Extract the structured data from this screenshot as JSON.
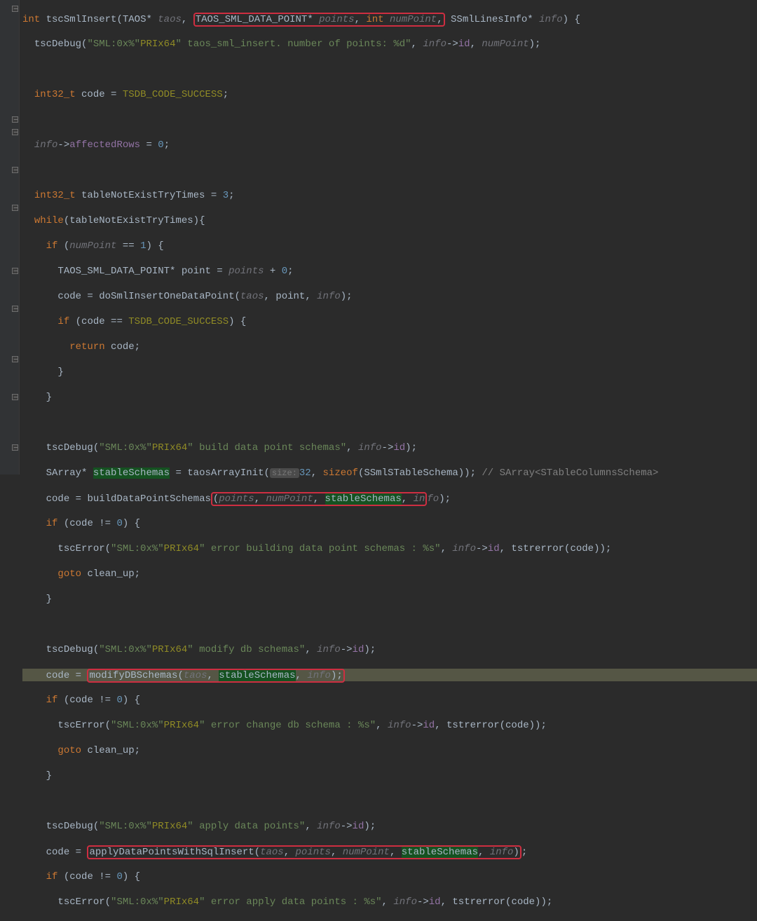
{
  "func": {
    "ret": "int",
    "name": "tscSmlInsert",
    "p_taos_ty": "TAOS*",
    "p_taos": "taos",
    "p_points_ty": "TAOS_SML_DATA_POINT*",
    "p_points": "points",
    "p_num_ty": "int",
    "p_num": "numPoint",
    "p_info_ty": "SSmlLinesInfo*",
    "p_info": "info"
  },
  "s": {
    "dbg_hdr": "\"SML:0x%\"",
    "prix64": "PRIx64",
    "dbg_numpts": "\" taos_sml_insert. number of points: %d\"",
    "dbg_build": "\" build data point schemas\"",
    "dbg_err_build": "\" error building data point schemas : %s\"",
    "dbg_modify": "\" modify db schemas\"",
    "dbg_err_modify": "\" error change db schema : %s\"",
    "dbg_apply": "\" apply data points\"",
    "dbg_err_apply": "\" error apply data points : %s\""
  },
  "n": {
    "zero": "0",
    "one": "1",
    "three": "3",
    "thirtytwo": "32"
  },
  "id": {
    "tscDebug": "tscDebug",
    "tscError": "tscError",
    "code": "code",
    "int32": "int32_t",
    "success": "TSDB_CODE_SUCCESS",
    "info": "info",
    "affectedRows": "affectedRows",
    "tableTry": "tableNotExistTryTimes",
    "while": "while",
    "if": "if",
    "return": "return",
    "goto": "goto",
    "clean_up": "clean_up",
    "points_ty": "TAOS_SML_DATA_POINT*",
    "point": "point",
    "points": "points",
    "doSmlInsert": "doSmlInsertOneDataPoint",
    "SArray": "SArray*",
    "stableSchemas": "stableSchemas",
    "taosArrayInit": "taosArrayInit",
    "sizeof": "sizeof",
    "SSmlSTable": "SSmlSTableSchema",
    "cmt_sarray": "// SArray<STableColumnsSchema>",
    "buildDPS": "buildDataPointSchemas",
    "modifyDB": "modifyDBSchemas",
    "applyDP": "applyDataPointsWithSqlInsert",
    "numPoint": "numPoint",
    "taos": "taos",
    "id": "id",
    "tstrerror": "tstrerror",
    "size_hint": "size:"
  }
}
